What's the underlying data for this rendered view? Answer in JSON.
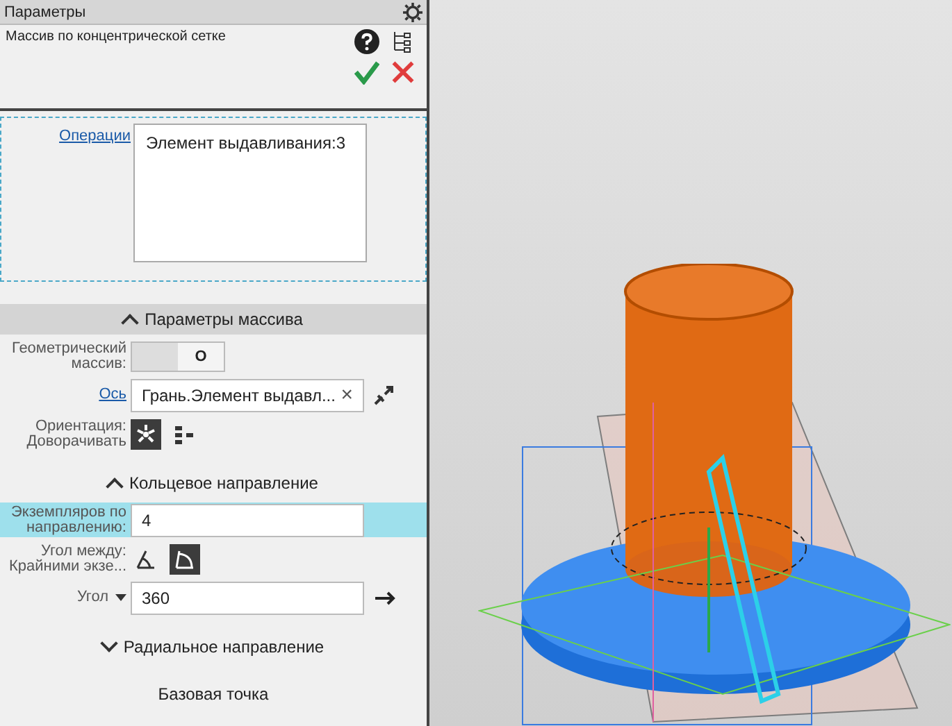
{
  "panel": {
    "title": "Параметры",
    "operation_name": "Массив по концентрической сетке"
  },
  "operations": {
    "label": "Операции",
    "items": [
      "Элемент выдавливания:3"
    ]
  },
  "array_params": {
    "title": "Параметры массива",
    "expanded": true,
    "geometric": {
      "label": "Геометрический массив:",
      "on": false,
      "toggle_text": "O"
    },
    "axis": {
      "label": "Ось",
      "value": "Грань.Элемент выдавл...",
      "clear": "×"
    },
    "orientation": {
      "label": "Ориентация:",
      "value": "Доворачивать",
      "options": [
        {
          "kind": "rotate",
          "selected": true
        },
        {
          "kind": "translate",
          "selected": false
        }
      ]
    }
  },
  "circular": {
    "title": "Кольцевое направление",
    "expanded": true,
    "count": {
      "label": "Экземпляров по направлению:",
      "value": "4",
      "highlighted": true
    },
    "angle_mode": {
      "label": "Угол между:",
      "value": "Крайними экзе...",
      "options": [
        {
          "kind": "between",
          "selected": false
        },
        {
          "kind": "extreme",
          "selected": true
        }
      ]
    },
    "angle": {
      "label": "Угол",
      "value": "360"
    }
  },
  "radial": {
    "title": "Радиальное направление",
    "expanded": false
  },
  "base_point": {
    "title": "Базовая точка"
  }
}
